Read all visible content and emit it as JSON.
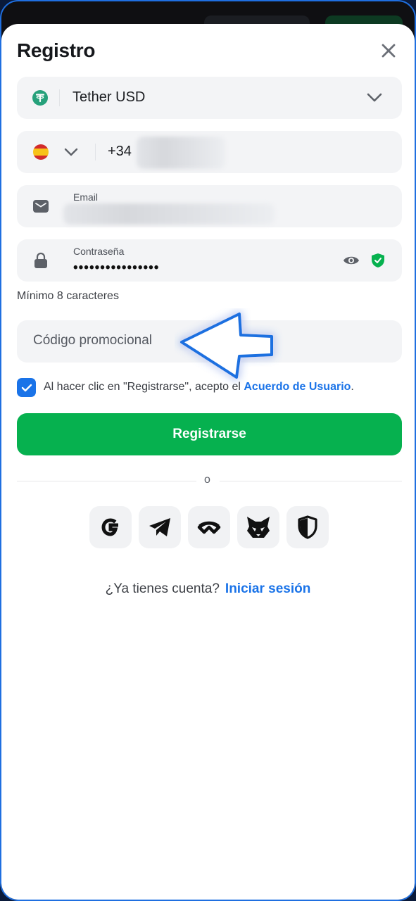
{
  "title": "Registro",
  "currency": {
    "name": "Tether USD",
    "icon": "tether-icon",
    "color": "#26a17b"
  },
  "phone": {
    "country": "spain-flag-icon",
    "prefix": "+34"
  },
  "email": {
    "label": "Email"
  },
  "password": {
    "label": "Contraseña",
    "masked_value": "••••••••••••••••"
  },
  "password_hint": "Mínimo 8 caracteres",
  "promo": {
    "placeholder": "Código promocional"
  },
  "terms": {
    "text": "Al hacer clic en \"Registrarse\", acepto el ",
    "link": "Acuerdo de Usuario",
    "suffix": ".",
    "checked": true
  },
  "register_button": "Registrarse",
  "divider_text": "o",
  "social_logins": [
    "google-icon",
    "telegram-icon",
    "walletconnect-icon",
    "metamask-icon",
    "shield-icon"
  ],
  "signin": {
    "question": "¿Ya tienes cuenta?",
    "link": "Iniciar sesión"
  },
  "colors": {
    "accent": "#1a73e8",
    "primary": "#06b14f",
    "field_bg": "#f3f4f6"
  }
}
